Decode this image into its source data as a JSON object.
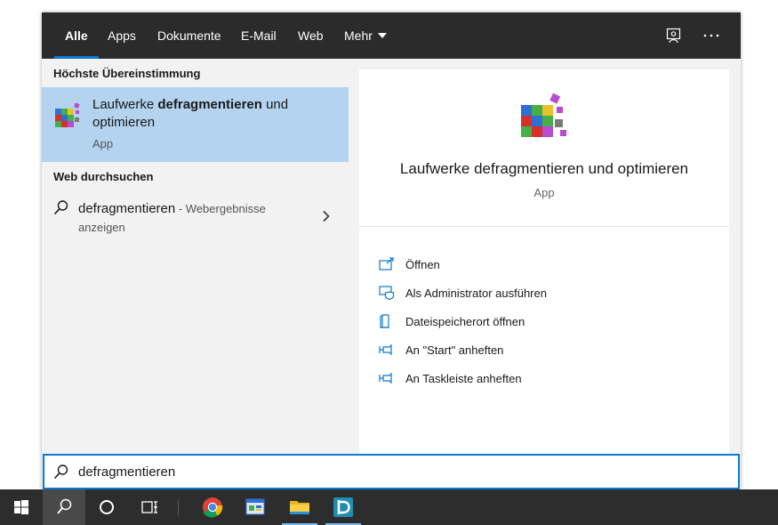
{
  "tabs": [
    {
      "label": "Alle",
      "active": true
    },
    {
      "label": "Apps"
    },
    {
      "label": "Dokumente"
    },
    {
      "label": "E-Mail"
    },
    {
      "label": "Web"
    },
    {
      "label": "Mehr"
    }
  ],
  "left": {
    "best_match_header": "Höchste Übereinstimmung",
    "best_match": {
      "title_pre": "Laufwerke ",
      "title_bold": "defragmentieren",
      "title_post": " und optimieren",
      "subtitle": "App"
    },
    "web_header": "Web durchsuchen",
    "web_result": {
      "query": "defragmentieren",
      "suffix": " - Webergebnisse anzeigen"
    }
  },
  "detail": {
    "title": "Laufwerke defragmentieren und optimieren",
    "subtitle": "App",
    "actions": [
      {
        "label": "Öffnen",
        "icon": "open-icon"
      },
      {
        "label": "Als Administrator ausführen",
        "icon": "shield-admin-icon"
      },
      {
        "label": "Dateispeicherort öffnen",
        "icon": "file-location-icon"
      },
      {
        "label": "An \"Start\" anheften",
        "icon": "pin-icon"
      },
      {
        "label": "An Taskleiste anheften",
        "icon": "pin-icon"
      }
    ]
  },
  "search": {
    "value": "defragmentieren"
  },
  "colors": {
    "accent": "#0a78d4",
    "selection": "#b3d3ef",
    "topbar": "#2b2b2b",
    "taskbar": "#2d2d2d"
  }
}
